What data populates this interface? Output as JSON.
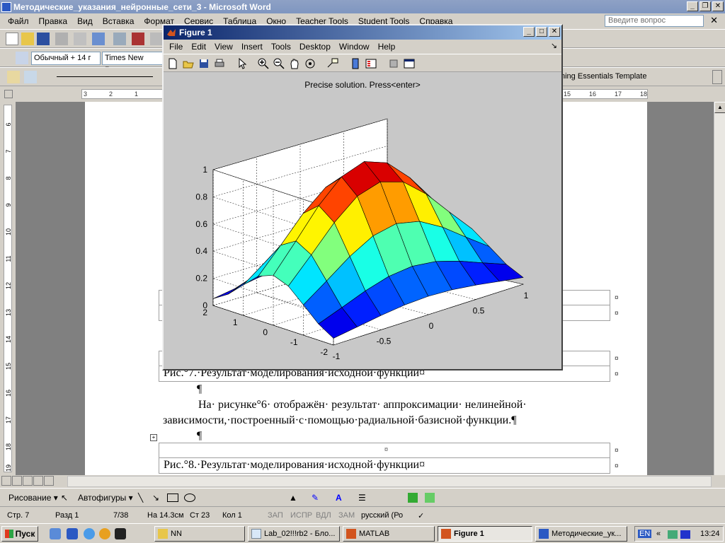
{
  "word": {
    "title": "Методические_указания_нейронные_сети_3 - Microsoft Word",
    "menu": [
      "Файл",
      "Правка",
      "Вид",
      "Вставка",
      "Формат",
      "Сервис",
      "Таблица",
      "Окно",
      "Teacher Tools",
      "Student Tools",
      "Справка"
    ],
    "ask_placeholder": "Введите вопрос",
    "style_combo": "Обычный + 14 г",
    "font_combo": "Times New Roma",
    "template_label": "ning Essentials Template",
    "ruler_h": [
      "3",
      "2",
      "1",
      "15",
      "16",
      "17",
      "18"
    ],
    "ruler_v": [
      "6",
      "7",
      "8",
      "9",
      "10",
      "11",
      "12",
      "13",
      "14",
      "15",
      "16",
      "17",
      "18",
      "19"
    ],
    "doc": {
      "pilcrow": "¶",
      "caption7": "Рис.°7.·Результат·моделирования·исходной·функции¤",
      "para_line1": "На· рисунке°6· отображён· результат· аппроксимации· нелинейной·",
      "para_line2": "зависимости,·построенный·с·помощью·радиальной·базисной·функции.¶",
      "caption8": "Рис.°8.·Результат·моделирования·исходной·функции¤",
      "cell_mark": "¤",
      "row_mark": "¤"
    },
    "draw_toolbar": {
      "drawing": "Рисование ▾",
      "autoshapes": "Автофигуры ▾"
    },
    "status": {
      "page": "Стр. 7",
      "section": "Разд 1",
      "pages": "7/38",
      "at": "На 14.3см",
      "line": "Ст 23",
      "col": "Кол 1",
      "rec": "ЗАП",
      "trk": "ИСПР",
      "ext": "ВДЛ",
      "ovr": "ЗАМ",
      "lang": "русский (Ро"
    }
  },
  "figure": {
    "title": "Figure 1",
    "menu": [
      "File",
      "Edit",
      "View",
      "Insert",
      "Tools",
      "Desktop",
      "Window",
      "Help"
    ]
  },
  "chart_data": {
    "type": "surface",
    "title": "Precise solution. Press<enter>",
    "xlabel": "",
    "ylabel": "",
    "zlabel": "",
    "x_ticks": [
      "-1",
      "-0.5",
      "0",
      "0.5",
      "1"
    ],
    "y_ticks": [
      "-2",
      "-1",
      "0",
      "1",
      "2"
    ],
    "z_ticks": [
      "0",
      "0.2",
      "0.4",
      "0.6",
      "0.8",
      "1"
    ],
    "xlim": [
      -1,
      1
    ],
    "ylim": [
      -2,
      2
    ],
    "zlim": [
      0,
      1
    ],
    "x": [
      -1,
      -0.75,
      -0.5,
      -0.25,
      0,
      0.25,
      0.5,
      0.75,
      1
    ],
    "y": [
      -2,
      -1.5,
      -1,
      -0.5,
      0,
      0.5,
      1,
      1.5,
      2
    ],
    "z_function": "exp(-(x^2 + y^2/2))",
    "colormap": "jet",
    "grid": true
  },
  "taskbar": {
    "start": "Пуск",
    "items": [
      "NN",
      "Lab_02!!!rb2 - Бло...",
      "MATLAB",
      "Figure 1",
      "Методические_ук..."
    ],
    "active_index": 3,
    "lang": "EN",
    "clock": "13:24"
  }
}
